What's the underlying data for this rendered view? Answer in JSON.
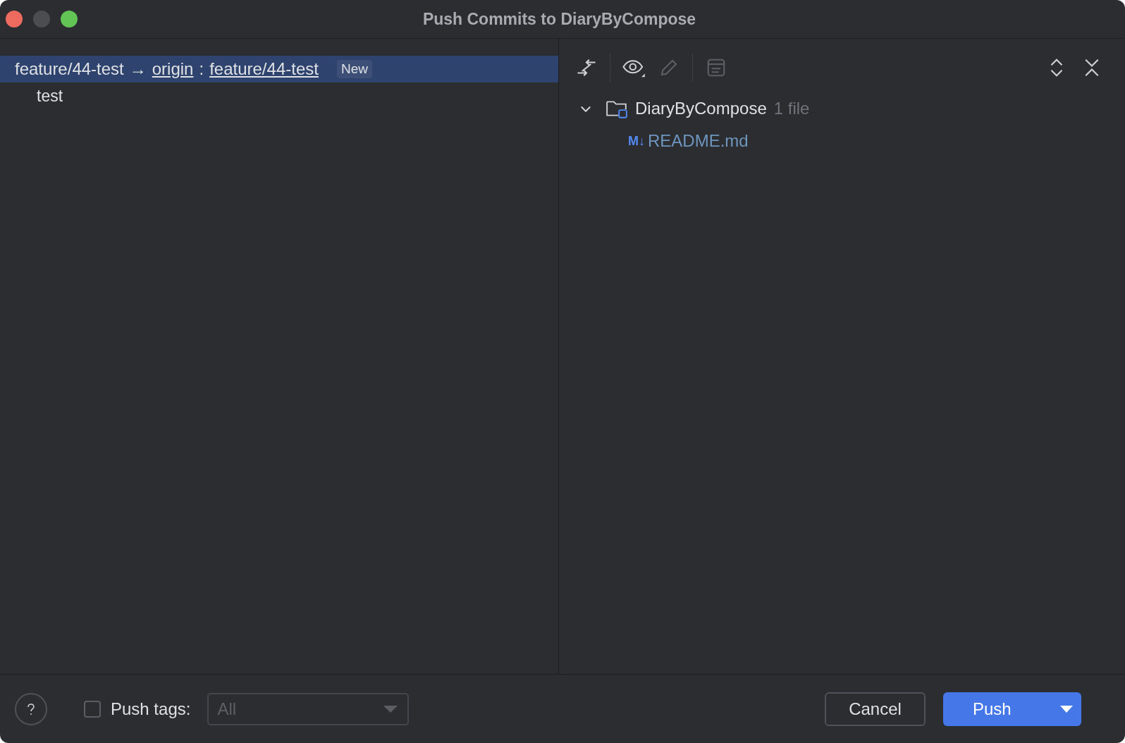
{
  "window": {
    "title": "Push Commits to DiaryByCompose"
  },
  "push_tree": [
    {
      "source": "feature/44-test",
      "arrow": "→",
      "remote": "origin",
      "separator": ":",
      "target": "feature/44-test",
      "badge": "New",
      "selected": true,
      "commits": [
        {
          "message": "test"
        }
      ]
    }
  ],
  "toolbar": [
    {
      "kind": "compare",
      "disabled": false
    },
    {
      "kind": "view",
      "disabled": false
    },
    {
      "kind": "edit",
      "disabled": true
    },
    {
      "kind": "preview",
      "disabled": true
    }
  ],
  "changes_tree": [
    {
      "name": "DiaryByCompose",
      "count": "1 file",
      "expanded": true,
      "children": [
        {
          "name": "README.md",
          "badge": "M↓"
        }
      ]
    }
  ],
  "footer": {
    "push_tags": {
      "label": "Push tags:",
      "checked": false
    },
    "tags_dropdown": {
      "value": "All",
      "disabled": true
    },
    "buttons": [
      {
        "kind": "cancel",
        "label": "Cancel"
      },
      {
        "kind": "push",
        "label": "Push"
      }
    ]
  }
}
